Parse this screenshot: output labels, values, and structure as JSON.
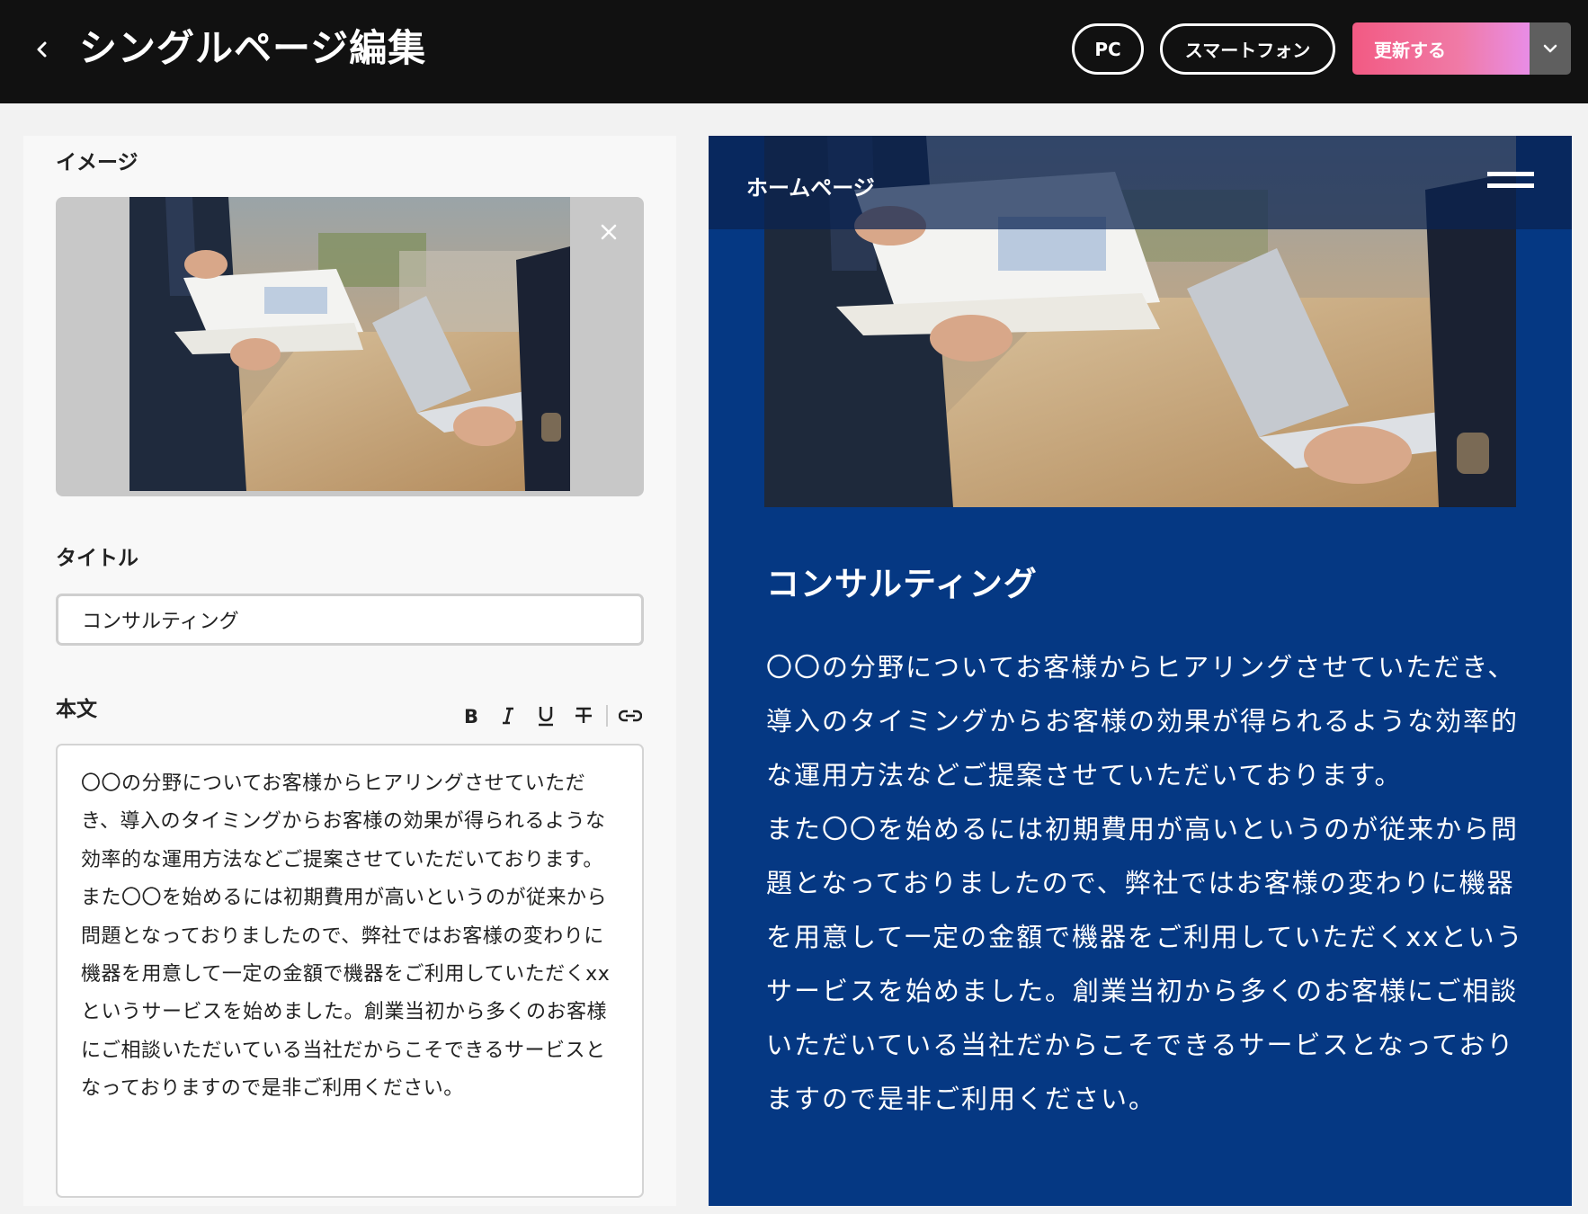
{
  "header": {
    "title": "シングルページ編集",
    "pc_label": "PC",
    "smartphone_label": "スマートフォン",
    "update_label": "更新する"
  },
  "editor": {
    "image_label": "イメージ",
    "title_label": "タイトル",
    "title_value": "コンサルティング",
    "body_label": "本文",
    "body_text": "〇〇の分野についてお客様からヒアリングさせていただき、導入のタイミングからお客様の効果が得られるような効率的な運用方法などご提案させていただいております。\nまた〇〇を始めるには初期費用が高いというのが従来から問題となっておりましたので、弊社ではお客様の変わりに機器を用意して一定の金額で機器をご利用していただくxxというサービスを始めました。創業当初から多くのお客様にご相談いただいている当社だからこそできるサービスとなっておりますので是非ご利用ください。"
  },
  "preview": {
    "nav_label": "ホームページ",
    "heading": "コンサルティング",
    "body_text": "〇〇の分野についてお客様からヒアリングさせていただき、導入のタイミングからお客様の効果が得られるような効率的な運用方法などご提案させていただいております。\nまた〇〇を始めるには初期費用が高いというのが従来から問題となっておりましたので、弊社ではお客様の変わりに機器を用意して一定の金額で機器をご利用していただくxxというサービスを始めました。創業当初から多くのお客様にご相談いただいている当社だからこそできるサービスとなっておりますので是非ご利用ください。"
  },
  "icons": {
    "back": "chevron-left-icon",
    "close": "close-icon",
    "dropdown": "chevron-down-icon",
    "bold": "bold-icon",
    "italic": "italic-icon",
    "underline": "underline-icon",
    "strikethrough": "strikethrough-icon",
    "link": "link-icon",
    "menu": "hamburger-menu-icon"
  },
  "colors": {
    "header_bg": "#111111",
    "update_gradient_start": "#f25a83",
    "update_gradient_end": "#e88de6",
    "preview_bg": "#053883"
  }
}
